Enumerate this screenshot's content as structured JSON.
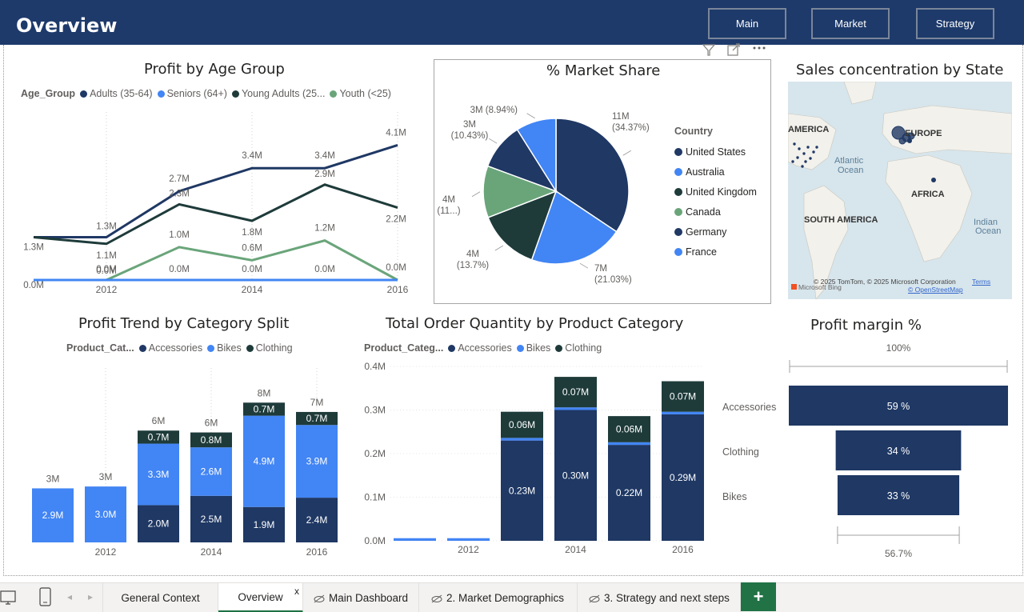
{
  "header": {
    "title": "Overview",
    "nav_buttons": [
      "Main",
      "Market",
      "Strategy"
    ]
  },
  "colors": {
    "header": "#1e3a6b",
    "navy": "#1f3864",
    "blue": "#4285f4",
    "dark": "#1e3b3a",
    "green": "#6aa57a",
    "map_water": "#d7e5ec"
  },
  "visuals": {
    "age": {
      "title": "Profit by Age Group",
      "legend_title": "Age_Group",
      "legend_items": [
        "Adults (35-64)",
        "Seniors (64+)",
        "Young Adults (25...",
        "Youth (<25)"
      ]
    },
    "pie": {
      "title": "% Market Share",
      "legend_title": "Country",
      "legend_items": [
        "United States",
        "Australia",
        "United Kingdom",
        "Canada",
        "Germany",
        "France"
      ]
    },
    "map": {
      "title": "Sales concentration by State",
      "labels": [
        "AMERICA",
        "EUROPE",
        "Atlantic",
        "Ocean",
        "AFRICA",
        "SOUTH AMERICA",
        "Indian",
        "Ocean"
      ],
      "copyright": "© 2025 TomTom, © 2025 Microsoft Corporation",
      "terms": "Terms",
      "osm": "© OpenStreetMap",
      "brand": "Microsoft Bing"
    },
    "category": {
      "title": "Profit Trend by Category Split",
      "legend_title": "Product_Cat...",
      "legend_items": [
        "Accessories",
        "Bikes",
        "Clothing"
      ]
    },
    "quantity": {
      "title": "Total Order Quantity by Product Category",
      "legend_title": "Product_Categ...",
      "legend_items": [
        "Accessories",
        "Bikes",
        "Clothing"
      ]
    },
    "margin": {
      "title": "Profit margin %"
    }
  },
  "chart_data": [
    {
      "id": "age",
      "type": "line",
      "title": "Profit by Age Group",
      "x": [
        2011,
        2012,
        2013,
        2014,
        2015,
        2016
      ],
      "x_tick_labels": [
        "2012",
        "2014",
        "2016"
      ],
      "series": [
        {
          "name": "Adults (35-64)",
          "color": "#1f3864",
          "values": [
            1.3,
            1.3,
            2.7,
            3.4,
            3.4,
            4.1
          ],
          "labels": [
            "1.3M",
            "1.3M",
            "2.7M",
            "3.4M",
            "3.4M",
            "4.1M"
          ]
        },
        {
          "name": "Young Adults (25...",
          "color": "#1e3b3a",
          "values": [
            1.3,
            1.1,
            2.3,
            1.8,
            2.9,
            2.2
          ],
          "labels": [
            "",
            "1.1M",
            "2.3M",
            "1.8M",
            "2.9M",
            "2.2M"
          ]
        },
        {
          "name": "Youth (<25)",
          "color": "#6aa57a",
          "values": [
            0.0,
            0.0,
            1.0,
            0.6,
            1.2,
            0.0
          ],
          "labels": [
            "0.0M",
            "0.0M",
            "1.0M",
            "0.6M",
            "1.2M",
            "0.0M"
          ]
        },
        {
          "name": "Seniors (64+)",
          "color": "#4285f4",
          "values": [
            0.0,
            0.0,
            0.0,
            0.0,
            0.0,
            0.0
          ],
          "labels": [
            "",
            "0.0M",
            "0.0M",
            "0.0M",
            "0.0M",
            ""
          ]
        }
      ],
      "ylim": [
        0,
        4.5
      ]
    },
    {
      "id": "pie",
      "type": "pie",
      "title": "% Market Share",
      "slices": [
        {
          "name": "United States",
          "value": 34.37,
          "color": "#1f3864",
          "label": "11M (34.37%)"
        },
        {
          "name": "Australia",
          "value": 21.03,
          "color": "#4285f4",
          "label": "7M (21.03%)"
        },
        {
          "name": "United Kingdom",
          "value": 13.7,
          "color": "#1e3b3a",
          "label": "4M (13.7%)"
        },
        {
          "name": "Canada",
          "value": 11.5,
          "color": "#6aa57a",
          "label": "4M (11...)"
        },
        {
          "name": "Germany",
          "value": 10.43,
          "color": "#1f3864",
          "label": "3M (10.43%)"
        },
        {
          "name": "France",
          "value": 8.94,
          "color": "#4285f4",
          "label": "3M (8.94%)"
        }
      ]
    },
    {
      "id": "category",
      "type": "bar",
      "stacked": true,
      "title": "Profit Trend by Category Split",
      "categories": [
        "2011",
        "2012",
        "2013",
        "2014",
        "2015",
        "2016"
      ],
      "x_tick_labels": [
        "2012",
        "2014",
        "2016"
      ],
      "series": [
        {
          "name": "Accessories",
          "color": "#1f3864",
          "values": [
            0,
            0,
            2.0,
            2.5,
            1.9,
            2.4
          ],
          "labels": [
            "",
            "",
            "2.0M",
            "2.5M",
            "1.9M",
            "2.4M"
          ]
        },
        {
          "name": "Bikes",
          "color": "#4285f4",
          "values": [
            2.9,
            3.0,
            3.3,
            2.6,
            4.9,
            3.9
          ],
          "labels": [
            "2.9M",
            "3.0M",
            "3.3M",
            "2.6M",
            "4.9M",
            "3.9M"
          ]
        },
        {
          "name": "Clothing",
          "color": "#1e3b3a",
          "values": [
            0,
            0,
            0.7,
            0.8,
            0.7,
            0.7
          ],
          "labels": [
            "",
            "",
            "0.7M",
            "0.8M",
            "0.7M",
            "0.7M"
          ]
        }
      ],
      "totals": [
        "3M",
        "3M",
        "6M",
        "6M",
        "8M",
        "7M"
      ],
      "ylim": [
        0,
        8.5
      ]
    },
    {
      "id": "quantity",
      "type": "bar",
      "stacked": true,
      "title": "Total Order Quantity by Product Category",
      "categories": [
        "2011",
        "2012",
        "2013",
        "2014",
        "2015",
        "2016"
      ],
      "x_tick_labels": [
        "2012",
        "2014",
        "2016"
      ],
      "y_ticks": [
        "0.0M",
        "0.1M",
        "0.2M",
        "0.3M",
        "0.4M"
      ],
      "series": [
        {
          "name": "Accessories",
          "color": "#1f3864",
          "values": [
            0,
            0,
            0.23,
            0.3,
            0.22,
            0.29
          ],
          "labels": [
            "",
            "",
            "0.23M",
            "0.30M",
            "0.22M",
            "0.29M"
          ]
        },
        {
          "name": "Bikes",
          "color": "#4285f4",
          "values": [
            0.006,
            0.006,
            0.006,
            0.006,
            0.006,
            0.006
          ],
          "labels": [
            "",
            "",
            "",
            "",
            "",
            ""
          ]
        },
        {
          "name": "Clothing",
          "color": "#1e3b3a",
          "values": [
            0,
            0,
            0.06,
            0.07,
            0.06,
            0.07
          ],
          "labels": [
            "",
            "",
            "0.06M",
            "0.07M",
            "0.06M",
            "0.07M"
          ]
        }
      ],
      "ylim": [
        0,
        0.4
      ]
    },
    {
      "id": "margin",
      "type": "bar",
      "orientation": "funnel",
      "title": "Profit margin %",
      "categories": [
        "Accessories",
        "Clothing",
        "Bikes"
      ],
      "values": [
        59,
        34,
        33
      ],
      "labels": [
        "59 %",
        "34 %",
        "33 %"
      ],
      "top_label": "100%",
      "bottom_label": "56.7%",
      "color": "#1f3864"
    }
  ],
  "tabs": {
    "pages": [
      "General Context",
      "Overview",
      "Main Dashboard",
      "2. Market Demographics",
      "3. Strategy and next steps"
    ],
    "close_label": "x",
    "add_label": "+"
  }
}
